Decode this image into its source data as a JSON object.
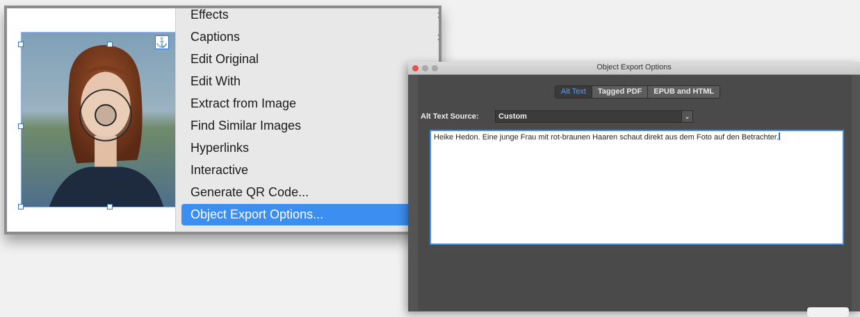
{
  "context_menu": {
    "items": [
      {
        "label": "Effects",
        "submenu": true
      },
      {
        "label": "Captions",
        "submenu": true
      },
      {
        "label": "Edit Original",
        "submenu": false
      },
      {
        "label": "Edit With",
        "submenu": true
      },
      {
        "label": "Extract from Image",
        "submenu": true
      },
      {
        "label": "Find Similar Images",
        "submenu": false
      },
      {
        "label": "Hyperlinks",
        "submenu": true
      },
      {
        "label": "Interactive",
        "submenu": true
      },
      {
        "label": "Generate QR Code...",
        "submenu": false
      },
      {
        "label": "Object Export Options...",
        "submenu": false,
        "selected": true
      }
    ],
    "chevron": "›"
  },
  "document": {
    "anchor_icon": "⚓",
    "photo_icon": "portrait-photo"
  },
  "dialog": {
    "title": "Object Export Options",
    "tabs": [
      {
        "label": "Alt Text",
        "active": true
      },
      {
        "label": "Tagged PDF",
        "active": false
      },
      {
        "label": "EPUB and HTML",
        "active": false
      }
    ],
    "alt_text_source_label": "Alt Text Source:",
    "alt_text_source_value": "Custom",
    "alt_text": "Heike Hedon. Eine junge Frau mit rot-braunen Haaren schaut direkt aus dem Foto auf den Betrachter."
  },
  "colors": {
    "menu_highlight": "#3c8ff0",
    "selection_blue": "#2f6fd6",
    "dialog_bg": "#4a4a4a",
    "traffic_red": "#e0524a",
    "traffic_inactive": "#a8a8a8"
  }
}
